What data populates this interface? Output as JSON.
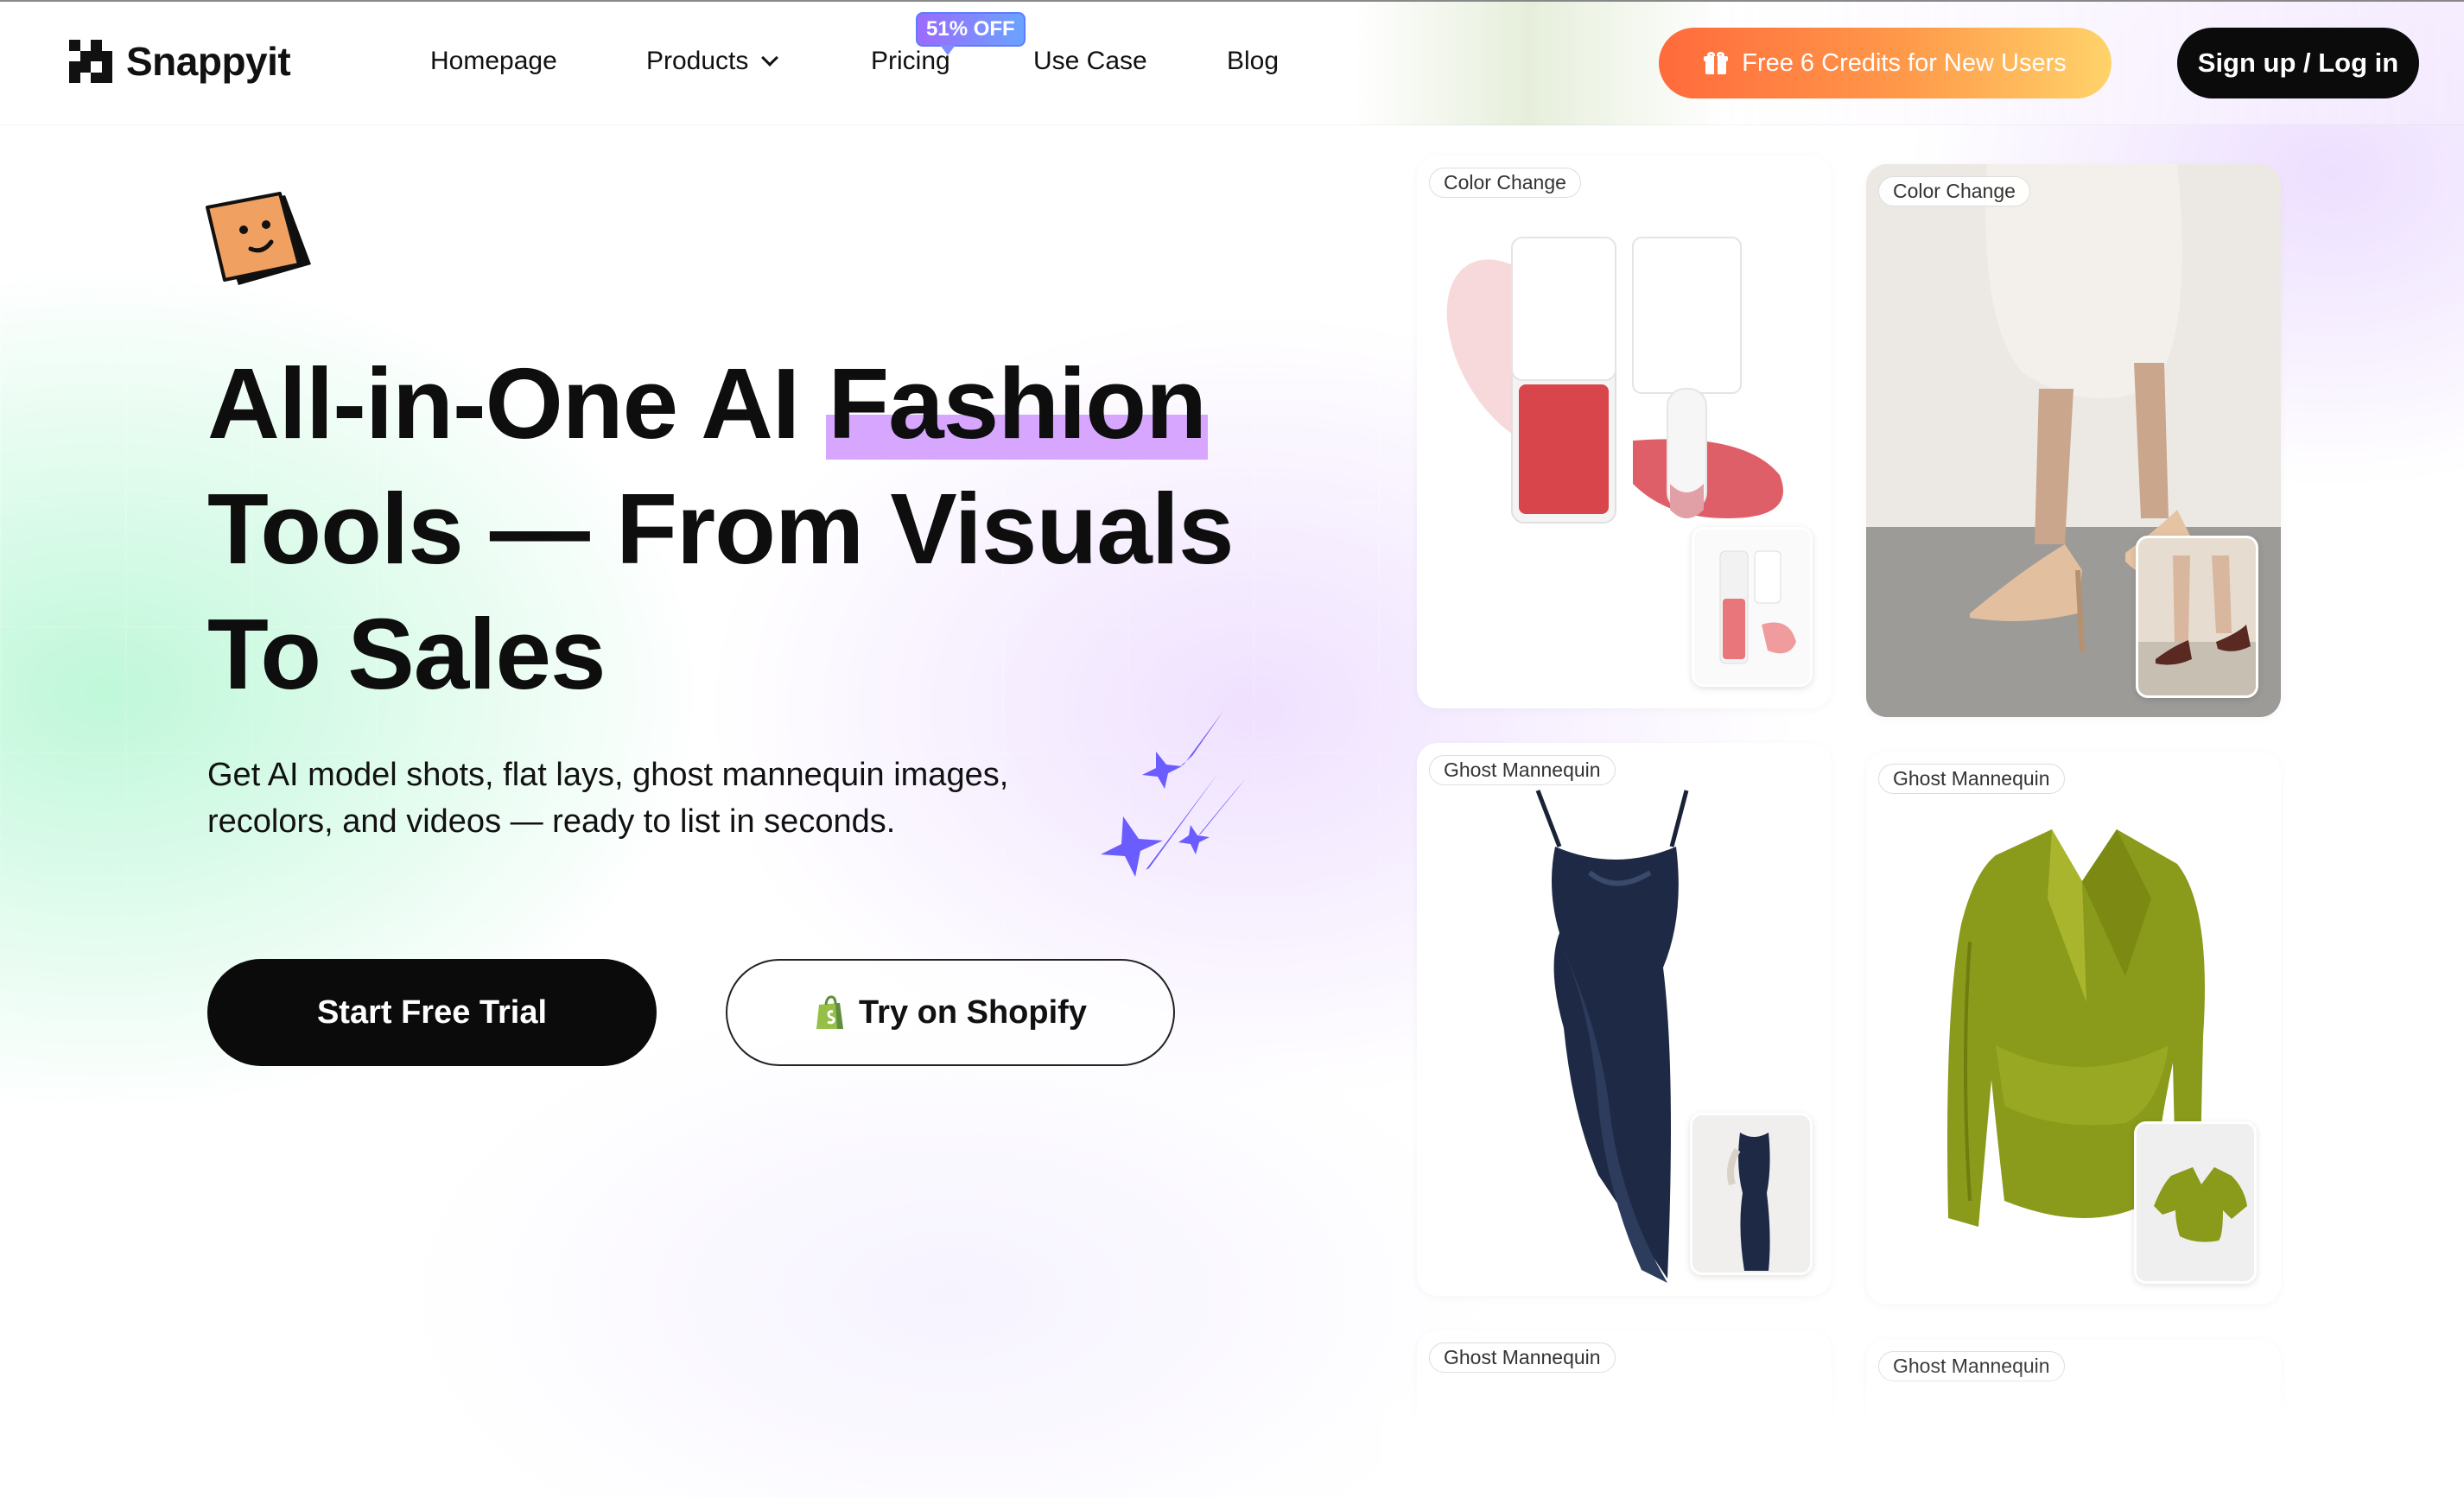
{
  "brand": {
    "name": "Snappyit",
    "logo_icon": "checker-logo-icon"
  },
  "nav": {
    "items": [
      {
        "label": "Homepage"
      },
      {
        "label": "Products",
        "icon": "chevron-down-icon"
      },
      {
        "label": "Pricing"
      },
      {
        "label": "Use Case"
      },
      {
        "label": "Blog"
      }
    ],
    "pricing_badge": "51% OFF"
  },
  "header_actions": {
    "credits_label": "Free 6 Credits for New Users",
    "credits_icon": "gift-icon",
    "signup_label": "Sign up / Log in"
  },
  "hero": {
    "title_part1": "All-in-One AI ",
    "title_highlight": "Fashion",
    "title_part2": " Tools — From Visuals To Sales",
    "subtitle_line1": "Get AI model shots, flat lays, ghost mannequin images,",
    "subtitle_line2": "recolors, and videos — ready to list in seconds.",
    "primary_cta": "Start Free Trial",
    "secondary_cta": "Try on Shopify",
    "secondary_icon": "shopify-bag-icon"
  },
  "gallery": {
    "cards": [
      {
        "tag": "Color Change",
        "subject": "lip-tint-bottle"
      },
      {
        "tag": "Color Change",
        "subject": "heels"
      },
      {
        "tag": "Ghost Mannequin",
        "subject": "navy-satin-dress"
      },
      {
        "tag": "Ghost Mannequin",
        "subject": "green-satin-blouse"
      },
      {
        "tag": "Ghost Mannequin",
        "subject": "partial"
      },
      {
        "tag": "Ghost Mannequin",
        "subject": "partial"
      }
    ]
  },
  "colors": {
    "accent_orange": "#ff6a3c",
    "accent_yellow": "#ffd36a",
    "highlight_purple": "#d7a6ff",
    "badge_purple": "#9b6bff",
    "sparkle_violet": "#6a5cff",
    "mascot_orange": "#f0a060"
  }
}
